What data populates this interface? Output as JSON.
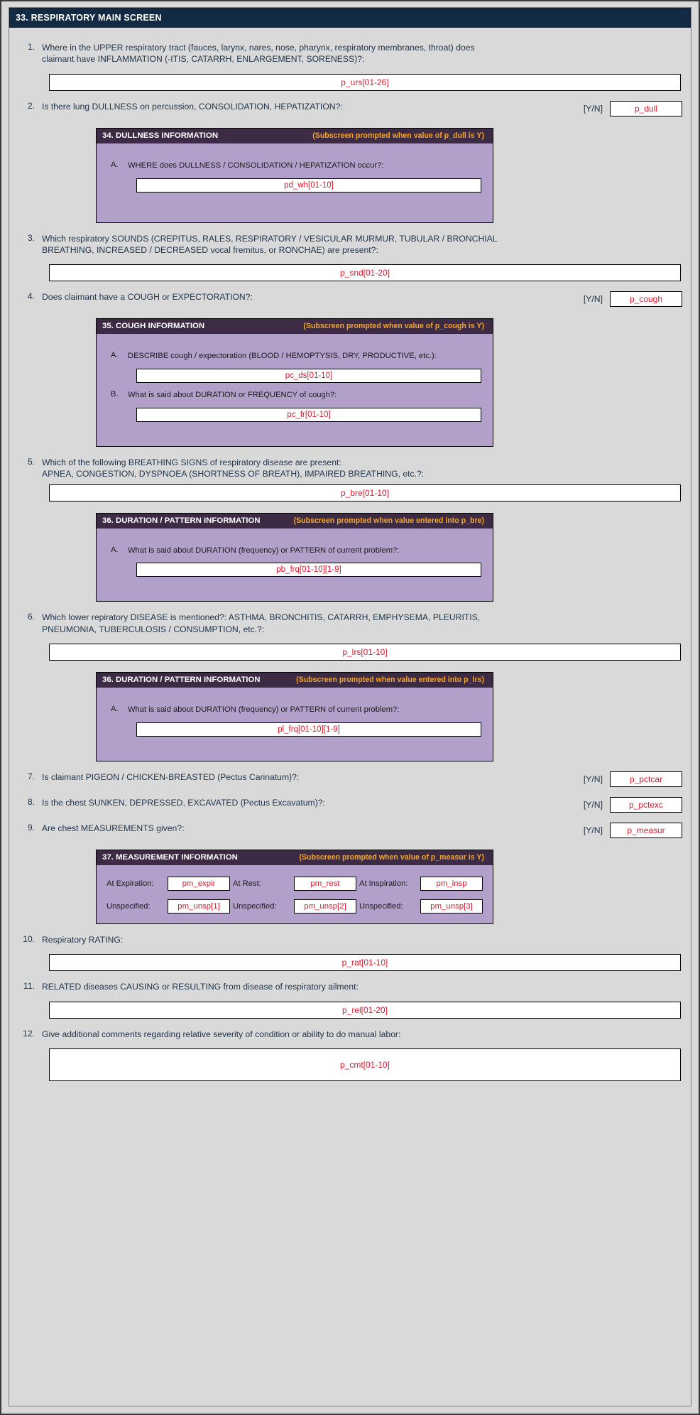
{
  "screen": {
    "title": "33. RESPIRATORY MAIN SCREEN",
    "yn_label": "[Y/N]"
  },
  "questions": [
    {
      "num": "1.",
      "text_line1": "Where in the UPPER respiratory tract (fauces, larynx, nares, nose, pharynx, respiratory membranes, throat) does",
      "text_line2": "claimant have INFLAMMATION (-ITIS, CATARRH, ENLARGEMENT, SORENESS)?:",
      "field": "p_urs[01-26]"
    },
    {
      "num": "2.",
      "text_line1": "Is there lung DULLNESS on percussion, CONSOLIDATION, HEPATIZATION?:",
      "yn_field": "p_dull"
    },
    {
      "num": "3.",
      "text_line1": "Which respiratory SOUNDS (CREPITUS, RALES, RESPIRATORY / VESICULAR MURMUR, TUBULAR / BRONCHIAL",
      "text_line2": "BREATHING, INCREASED / DECREASED vocal fremitus, or RONCHAE) are present?:",
      "field": "p_snd[01-20]"
    },
    {
      "num": "4.",
      "text_line1": "Does claimant have a COUGH or EXPECTORATION?:",
      "yn_field": "p_cough"
    },
    {
      "num": "5.",
      "text_line1": "Which of the following BREATHING SIGNS of respiratory disease are present:",
      "text_line2": " APNEA, CONGESTION, DYSPNOEA (SHORTNESS OF BREATH), IMPAIRED BREATHING, etc.?:",
      "field": "p_bre[01-10]"
    },
    {
      "num": "6.",
      "text_line1": "Which lower repiratory DISEASE is mentioned?: ASTHMA, BRONCHITIS, CATARRH, EMPHYSEMA, PLEURITIS,",
      "text_line2": "PNEUMONIA, TUBERCULOSIS /  CONSUMPTION, etc.?:",
      "field": "p_lrs[01-10]"
    },
    {
      "num": "7.",
      "text_line1": "Is claimant PIGEON / CHICKEN-BREASTED (Pectus Carinatum)?:",
      "yn_field": "p_pctcar"
    },
    {
      "num": "8.",
      "text_line1": "Is the chest SUNKEN, DEPRESSED, EXCAVATED (Pectus Excavatum)?:",
      "yn_field": "p_pctexc"
    },
    {
      "num": "9.",
      "text_line1": "Are chest MEASUREMENTS given?:",
      "yn_field": "p_measur"
    },
    {
      "num": "10.",
      "text_line1": "Respiratory RATING:",
      "field": "p_rat[01-10]"
    },
    {
      "num": "11.",
      "text_line1": "RELATED diseases CAUSING or RESULTING from disease of respiratory ailment:",
      "field": "p_rel[01-20]"
    },
    {
      "num": "12.",
      "text_line1": "Give additional comments regarding relative severity of condition or ability to do manual labor:",
      "field": "p_cmt[01-10]"
    }
  ],
  "subscreens": {
    "dullness": {
      "title": "34. DULLNESS INFORMATION",
      "note": "(Subscreen prompted when value of p_dull is Y)",
      "items": [
        {
          "letter": "A.",
          "label": "WHERE does DULLNESS / CONSOLIDATION / HEPATIZATION occur?:",
          "field": "pd_wh[01-10]"
        }
      ]
    },
    "cough": {
      "title": "35. COUGH INFORMATION",
      "note": "(Subscreen prompted when value of p_cough is Y)",
      "items": [
        {
          "letter": "A.",
          "label": "DESCRIBE cough / expectoration (BLOOD / HEMOPTYSIS, DRY, PRODUCTIVE, etc.):",
          "field": "pc_ds[01-10]"
        },
        {
          "letter": "B.",
          "label": "What is said about DURATION or FREQUENCY of cough?:",
          "field": "pc_fr[01-10]"
        }
      ]
    },
    "duration_bre": {
      "title": "36. DURATION / PATTERN INFORMATION",
      "note": "(Subscreen prompted when value entered into p_bre)",
      "items": [
        {
          "letter": "A.",
          "label": "What is said about DURATION (frequency) or PATTERN of current problem?:",
          "field": "pb_frq[01-10][1-9]"
        }
      ]
    },
    "duration_lrs": {
      "title": "36. DURATION / PATTERN INFORMATION",
      "note": "(Subscreen prompted when value entered into p_lrs)",
      "items": [
        {
          "letter": "A.",
          "label": "What is said about DURATION (frequency) or PATTERN of current problem?:",
          "field": "pl_frq[01-10][1-9]"
        }
      ]
    },
    "measurement": {
      "title": "37. MEASUREMENT INFORMATION",
      "note": "(Subscreen prompted when value of p_measur is Y)",
      "row1": [
        {
          "label": "At Expiration:",
          "field": "pm_expir"
        },
        {
          "label": "At Rest:",
          "field": "pm_rest"
        },
        {
          "label": "At Inspiration:",
          "field": "pm_insp"
        }
      ],
      "row2": [
        {
          "label": "Unspecified:",
          "field": "pm_unsp[1]"
        },
        {
          "label": "Unspecified:",
          "field": "pm_unsp[2]"
        },
        {
          "label": "Unspecified:",
          "field": "pm_unsp[3]"
        }
      ]
    }
  }
}
